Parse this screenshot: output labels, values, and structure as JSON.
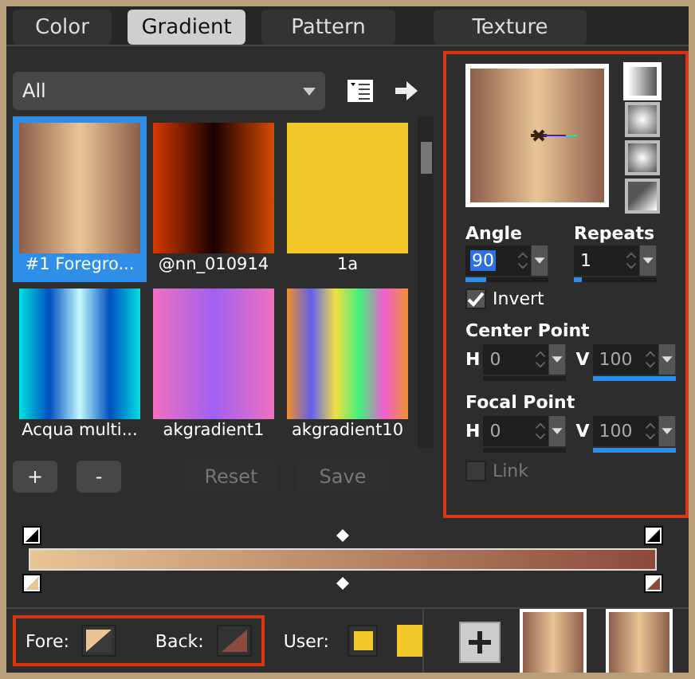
{
  "tabs": [
    {
      "label": "Color",
      "selected": false
    },
    {
      "label": "Gradient",
      "selected": true
    },
    {
      "label": "Pattern",
      "selected": false
    },
    {
      "label": "Texture",
      "selected": false
    }
  ],
  "category": {
    "value": "All"
  },
  "gradients": [
    {
      "label": "#1 Foregro...",
      "selected": true
    },
    {
      "label": "@nn_010914",
      "selected": false
    },
    {
      "label": "1a",
      "selected": false
    },
    {
      "label": "Acqua multi...",
      "selected": false
    },
    {
      "label": "akgradient1",
      "selected": false
    },
    {
      "label": "akgradient10",
      "selected": false
    }
  ],
  "library_buttons": [
    {
      "label": "+",
      "disabled": false
    },
    {
      "label": "-",
      "disabled": false
    },
    {
      "label": "Reset",
      "disabled": true
    },
    {
      "label": "Save",
      "disabled": true
    }
  ],
  "styles": [
    {
      "kind": "linear",
      "selected": true
    },
    {
      "kind": "rectangular",
      "selected": false
    },
    {
      "kind": "sunburst",
      "selected": false
    },
    {
      "kind": "radial",
      "selected": false
    }
  ],
  "angle": {
    "label": "Angle",
    "value": "90",
    "level": 0.25
  },
  "repeats": {
    "label": "Repeats",
    "value": "1",
    "level": 0.1
  },
  "invert": {
    "label": "Invert",
    "checked": true
  },
  "center_point": {
    "label": "Center Point",
    "h": {
      "label": "H",
      "value": "0",
      "disabled": true
    },
    "v": {
      "label": "V",
      "value": "100",
      "level": 1,
      "disabled": true
    }
  },
  "focal_point": {
    "label": "Focal Point",
    "h": {
      "label": "H",
      "value": "0",
      "disabled": true
    },
    "v": {
      "label": "V",
      "value": "100",
      "level": 1,
      "disabled": true
    }
  },
  "link": {
    "label": "Link",
    "checked": false,
    "disabled": true
  },
  "fore": {
    "label": "Fore:",
    "color": "#e8c596"
  },
  "back": {
    "label": "Back:",
    "color": "#8c4a3a"
  },
  "user": {
    "label": "User:",
    "swatches": [
      {
        "color": "#f2c72a"
      },
      {
        "color": "#f2c72a"
      }
    ]
  }
}
